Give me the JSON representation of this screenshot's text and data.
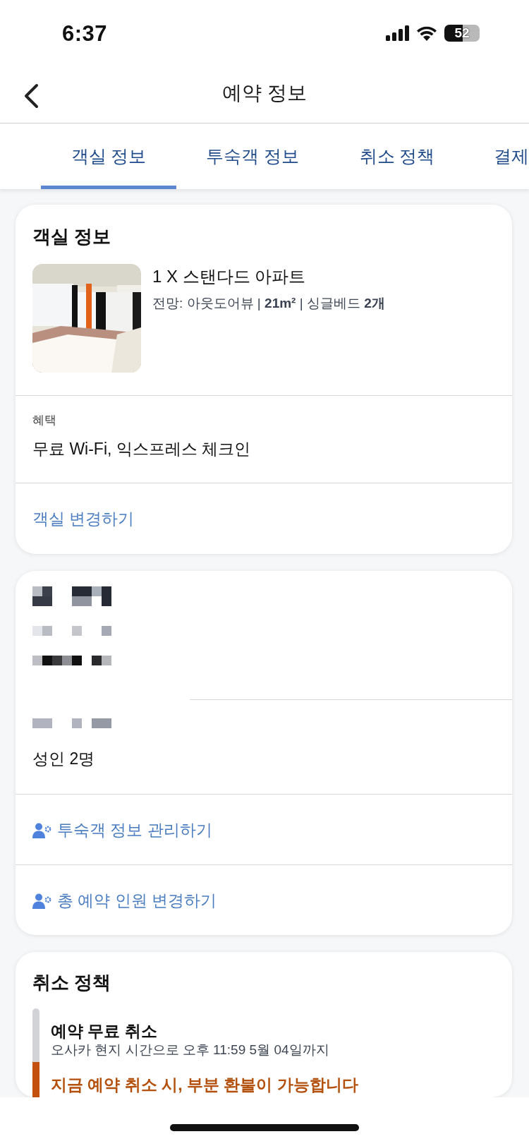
{
  "status_bar": {
    "time": "6:37",
    "battery": "52"
  },
  "header": {
    "title": "예약 정보"
  },
  "tabs": [
    {
      "label": "객실 정보",
      "selected": true
    },
    {
      "label": "투숙객 정보",
      "selected": false
    },
    {
      "label": "취소 정책",
      "selected": false
    },
    {
      "label": "결제",
      "selected": false
    }
  ],
  "room_card": {
    "title": "객실 정보",
    "room_name": "1 X 스탠다드 아파트",
    "details": "전망: 아웃도어뷰 | **21m²** | 싱글베드 **2개**",
    "benefits_label": "혜택",
    "benefits": "무료 Wi-Fi, 익스프레스 체크인",
    "change_link": "객실 변경하기"
  },
  "guest_card": {
    "guests": "성인 2명",
    "links": [
      "투숙객 정보 관리하기",
      "총 예약 인원 변경하기"
    ]
  },
  "cancel_policy": {
    "title": "취소 정책",
    "steps": [
      {
        "title": "예약 무료 취소",
        "subtitle": "오사카 현지 시간으로 오후 11:59 5월 04일까지",
        "kind": "neutral",
        "color": "#d2d3d7"
      },
      {
        "title": "지금 예약 취소 시, 부분 환불이 가능합니다",
        "kind": "warning",
        "color": "#c4500f"
      }
    ]
  }
}
